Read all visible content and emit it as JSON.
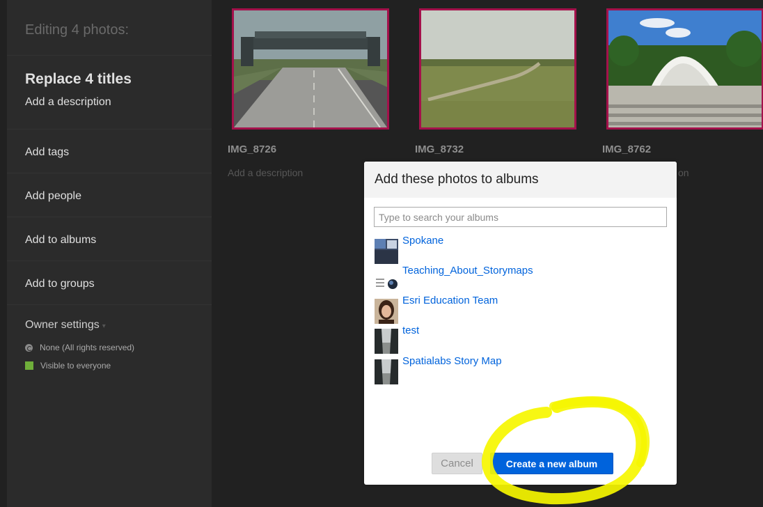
{
  "sidebar": {
    "header": "Editing 4 photos:",
    "titles_label": "Replace 4 titles",
    "description_label": "Add a description",
    "tags_label": "Add tags",
    "people_label": "Add people",
    "albums_label": "Add to albums",
    "groups_label": "Add to groups",
    "owner_settings_label": "Owner settings",
    "license_label": "None (All rights reserved)",
    "visibility_label": "Visible to everyone"
  },
  "photos": [
    {
      "title": "IMG_8726",
      "description": "Add a description"
    },
    {
      "title": "IMG_8732"
    },
    {
      "title": "IMG_8762",
      "description_fragment": "on"
    }
  ],
  "modal": {
    "title": "Add these photos to albums",
    "search_placeholder": "Type to search your albums",
    "albums": [
      {
        "name": "Spokane"
      },
      {
        "name": "Teaching_About_Storymaps"
      },
      {
        "name": "Esri Education Team"
      },
      {
        "name": "test"
      },
      {
        "name": "Spatialabs Story Map"
      }
    ],
    "cancel_label": "Cancel",
    "create_label": "Create a new album"
  },
  "colors": {
    "background": "#212121",
    "sidebar": "#2b2b2b",
    "selection_border": "#a4114b",
    "link_blue": "#0063dc",
    "highlight_yellow": "#f6f600",
    "visible_green": "#6fae3a"
  }
}
